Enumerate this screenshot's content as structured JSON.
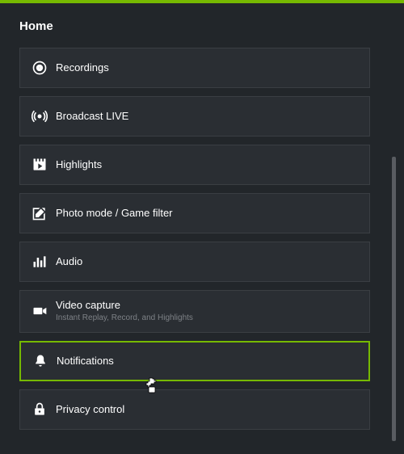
{
  "header": {
    "title": "Home"
  },
  "accent_color": "#76b900",
  "menu": {
    "items": [
      {
        "id": "recordings",
        "label": "Recordings",
        "sub": null
      },
      {
        "id": "broadcast-live",
        "label": "Broadcast LIVE",
        "sub": null
      },
      {
        "id": "highlights",
        "label": "Highlights",
        "sub": null
      },
      {
        "id": "photo-mode",
        "label": "Photo mode / Game filter",
        "sub": null
      },
      {
        "id": "audio",
        "label": "Audio",
        "sub": null
      },
      {
        "id": "video-capture",
        "label": "Video capture",
        "sub": "Instant Replay, Record, and Highlights"
      },
      {
        "id": "notifications",
        "label": "Notifications",
        "sub": null
      },
      {
        "id": "privacy",
        "label": "Privacy control",
        "sub": null
      }
    ],
    "selected_index": 6
  }
}
